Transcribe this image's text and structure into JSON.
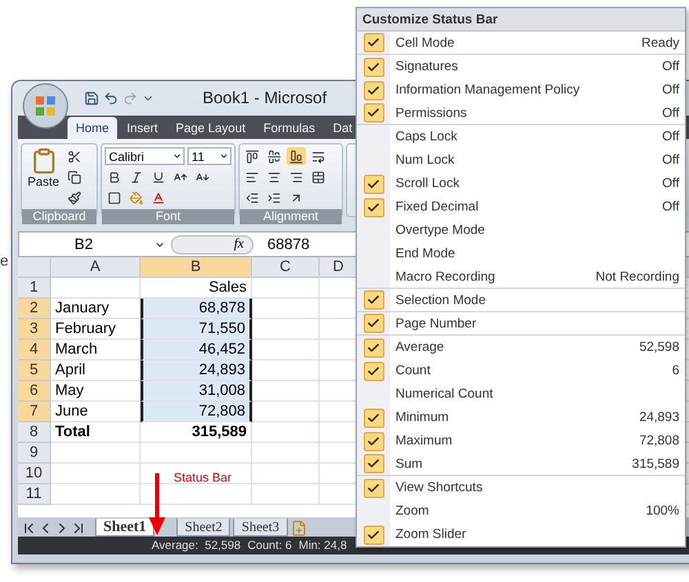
{
  "stray_text": "e",
  "window": {
    "title": "Book1 - Microsof",
    "tabs": [
      {
        "label": "Home",
        "selected": true
      },
      {
        "label": "Insert",
        "selected": false
      },
      {
        "label": "Page Layout",
        "selected": false
      },
      {
        "label": "Formulas",
        "selected": false
      },
      {
        "label": "Dat",
        "selected": false
      }
    ],
    "ribbon": {
      "paste_label": "Paste",
      "font_name": "Calibri",
      "font_size": "11",
      "groups": [
        "Clipboard",
        "Font",
        "Alignment"
      ]
    },
    "formula_bar": {
      "name_box": "B2",
      "function_label": "fx",
      "value": "68878"
    },
    "grid": {
      "columns": [
        {
          "label": "A",
          "selected": false
        },
        {
          "label": "B",
          "selected": true
        },
        {
          "label": "C",
          "selected": false
        },
        {
          "label": "D",
          "selected": false
        }
      ],
      "rows": [
        {
          "header": "1",
          "selected": false,
          "bold": false,
          "cells": [
            "",
            "Sales"
          ]
        },
        {
          "header": "2",
          "selected": true,
          "bold": false,
          "cells": [
            "January",
            "68,878"
          ]
        },
        {
          "header": "3",
          "selected": true,
          "bold": false,
          "cells": [
            "February",
            "71,550"
          ]
        },
        {
          "header": "4",
          "selected": true,
          "bold": false,
          "cells": [
            "March",
            "46,452"
          ]
        },
        {
          "header": "5",
          "selected": true,
          "bold": false,
          "cells": [
            "April",
            "24,893"
          ]
        },
        {
          "header": "6",
          "selected": true,
          "bold": false,
          "cells": [
            "May",
            "31,008"
          ]
        },
        {
          "header": "7",
          "selected": true,
          "bold": false,
          "cells": [
            "June",
            "72,808"
          ]
        },
        {
          "header": "8",
          "selected": false,
          "bold": true,
          "cells": [
            "Total",
            "315,589"
          ]
        },
        {
          "header": "9",
          "selected": false,
          "bold": false,
          "cells": [
            "",
            ""
          ]
        },
        {
          "header": "10",
          "selected": false,
          "bold": false,
          "cells": [
            "",
            ""
          ]
        },
        {
          "header": "11",
          "selected": false,
          "bold": false,
          "cells": [
            "",
            ""
          ]
        }
      ]
    },
    "sheet_tabs": [
      {
        "label": "Sheet1",
        "selected": true
      },
      {
        "label": "Sheet2",
        "selected": false
      },
      {
        "label": "Sheet3",
        "selected": false
      }
    ],
    "status_bar": [
      "Average:  52,598",
      "Count: 6",
      "Min: 24,8"
    ]
  },
  "annotation": {
    "label": "Status Bar"
  },
  "menu": {
    "title": "Customize Status Bar",
    "items": [
      {
        "label": "Cell Mode",
        "value": "Ready",
        "checked": true,
        "separator_after": true
      },
      {
        "label": "Signatures",
        "value": "Off",
        "checked": true,
        "separator_after": false
      },
      {
        "label": "Information Management Policy",
        "value": "Off",
        "checked": true,
        "separator_after": false
      },
      {
        "label": "Permissions",
        "value": "Off",
        "checked": true,
        "separator_after": true
      },
      {
        "label": "Caps Lock",
        "value": "Off",
        "checked": false,
        "separator_after": false
      },
      {
        "label": "Num Lock",
        "value": "Off",
        "checked": false,
        "separator_after": false
      },
      {
        "label": "Scroll Lock",
        "value": "Off",
        "checked": true,
        "separator_after": false
      },
      {
        "label": "Fixed Decimal",
        "value": "Off",
        "checked": true,
        "separator_after": false
      },
      {
        "label": "Overtype Mode",
        "value": "",
        "checked": false,
        "separator_after": false
      },
      {
        "label": "End Mode",
        "value": "",
        "checked": false,
        "separator_after": false
      },
      {
        "label": "Macro Recording",
        "value": "Not Recording",
        "checked": false,
        "separator_after": true
      },
      {
        "label": "Selection Mode",
        "value": "",
        "checked": true,
        "separator_after": true
      },
      {
        "label": "Page Number",
        "value": "",
        "checked": true,
        "separator_after": true
      },
      {
        "label": "Average",
        "value": "52,598",
        "checked": true,
        "separator_after": false
      },
      {
        "label": "Count",
        "value": "6",
        "checked": true,
        "separator_after": false
      },
      {
        "label": "Numerical Count",
        "value": "",
        "checked": false,
        "separator_after": false
      },
      {
        "label": "Minimum",
        "value": "24,893",
        "checked": true,
        "separator_after": false
      },
      {
        "label": "Maximum",
        "value": "72,808",
        "checked": true,
        "separator_after": false
      },
      {
        "label": "Sum",
        "value": "315,589",
        "checked": true,
        "separator_after": true
      },
      {
        "label": "View Shortcuts",
        "value": "",
        "checked": true,
        "separator_after": false
      },
      {
        "label": "Zoom",
        "value": "100%",
        "checked": false,
        "separator_after": false
      },
      {
        "label": "Zoom Slider",
        "value": "",
        "checked": true,
        "separator_after": false
      }
    ]
  }
}
